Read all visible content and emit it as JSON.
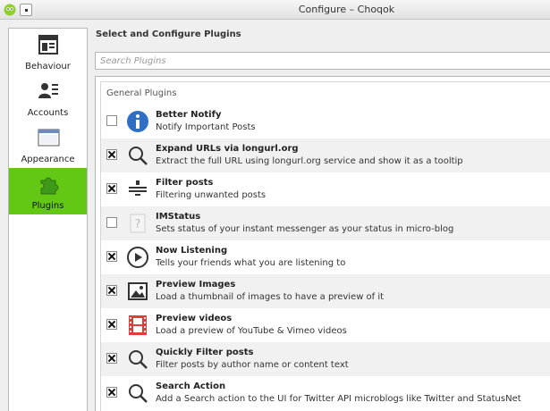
{
  "window": {
    "title": "Configure – Choqok"
  },
  "sidebar": {
    "items": [
      {
        "label": "Behaviour",
        "icon": "behaviour-icon",
        "active": false
      },
      {
        "label": "Accounts",
        "icon": "accounts-icon",
        "active": false
      },
      {
        "label": "Appearance",
        "icon": "appearance-icon",
        "active": false
      },
      {
        "label": "Plugins",
        "icon": "plugins-icon",
        "active": true
      }
    ],
    "active_color": "#62c814"
  },
  "main": {
    "title": "Select and Configure Plugins",
    "search": {
      "placeholder": "Search Plugins",
      "value": ""
    },
    "group_label": "General Plugins",
    "plugins": [
      {
        "name": "Better Notify",
        "desc": "Notify Important Posts",
        "checked": false,
        "icon": "info-icon"
      },
      {
        "name": "Expand URLs via longurl.org",
        "desc": "Extract the full URL using longurl.org service and show it as a tooltip",
        "checked": true,
        "icon": "search-icon"
      },
      {
        "name": "Filter posts",
        "desc": "Filtering unwanted posts",
        "checked": true,
        "icon": "filter-icon"
      },
      {
        "name": "IMStatus",
        "desc": "Sets status of your instant messenger as your status in micro-blog",
        "checked": false,
        "icon": "unknown-icon"
      },
      {
        "name": "Now Listening",
        "desc": "Tells your friends what you are listening to",
        "checked": true,
        "icon": "play-icon"
      },
      {
        "name": "Preview Images",
        "desc": "Load a thumbnail of images to have a preview of it",
        "checked": true,
        "icon": "image-icon"
      },
      {
        "name": "Preview videos",
        "desc": "Load a preview of YouTube & Vimeo videos",
        "checked": true,
        "icon": "film-icon"
      },
      {
        "name": "Quickly Filter posts",
        "desc": "Filter posts by author name or content text",
        "checked": true,
        "icon": "search-icon"
      },
      {
        "name": "Search Action",
        "desc": "Add a Search action to the UI for Twitter API microblogs like Twitter and StatusNet",
        "checked": true,
        "icon": "search-icon"
      }
    ]
  }
}
